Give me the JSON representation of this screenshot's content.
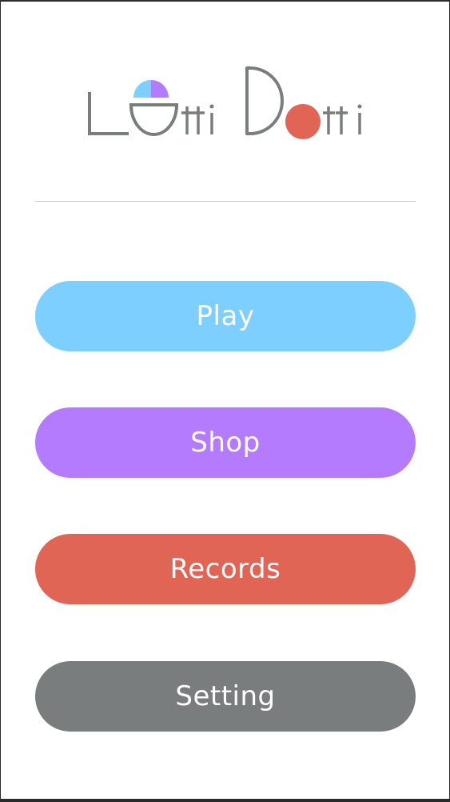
{
  "app": {
    "title_part1": "Lotti",
    "title_part2": "Dotti"
  },
  "colors": {
    "play": "#7ccfff",
    "shop": "#b57bff",
    "records": "#e06554",
    "setting": "#7a7d7e",
    "logo_gray": "#7a7d7e"
  },
  "menu": {
    "play_label": "Play",
    "shop_label": "Shop",
    "records_label": "Records",
    "setting_label": "Setting"
  }
}
